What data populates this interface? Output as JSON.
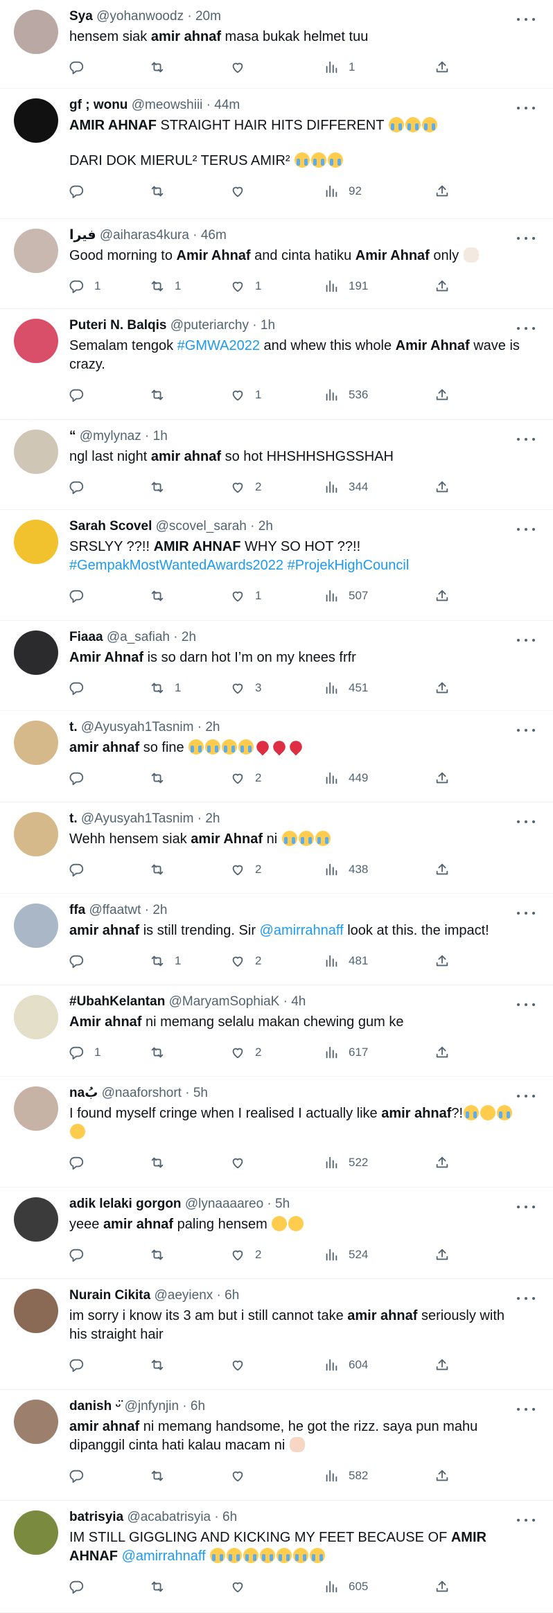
{
  "tweets": [
    {
      "name": "Sya",
      "handle": "@yohanwoodz",
      "time": "20m",
      "avatar": "#b9a8a3",
      "body": [
        [
          {
            "t": "hensem siak "
          },
          {
            "t": "amir ahnaf",
            "b": true
          },
          {
            "t": " masa bukak helmet tuu"
          }
        ]
      ],
      "reply": "",
      "retweet": "",
      "like": "",
      "views": "1",
      "h": 128
    },
    {
      "name": "gf ; wonu",
      "handle": "@meowshiii",
      "time": "44m",
      "avatar": "#111111",
      "body": [
        [
          {
            "t": "AMIR AHNAF",
            "b": true
          },
          {
            "t": " STRAIGHT HAIR HITS DIFFERENT "
          },
          {
            "e": "crying"
          },
          {
            "e": "crying"
          },
          {
            "e": "crying"
          }
        ],
        [
          {
            "t": "DARI DOK MIERUL² TERUS AMIR² "
          },
          {
            "e": "crying"
          },
          {
            "e": "crying"
          },
          {
            "e": "crying"
          }
        ]
      ],
      "reply": "",
      "retweet": "",
      "like": "",
      "views": "92",
      "h": 188
    },
    {
      "name": "فيرا",
      "handle": "@aiharas4kura",
      "time": "46m",
      "avatar": "#c8b8b0",
      "body": [
        [
          {
            "t": "Good morning to "
          },
          {
            "t": "Amir Ahnaf",
            "b": true
          },
          {
            "t": " and cinta hatiku "
          },
          {
            "t": "Amir Ahnaf",
            "b": true
          },
          {
            "t": " only "
          },
          {
            "e": "heart-hands"
          }
        ]
      ],
      "reply": "1",
      "retweet": "1",
      "like": "1",
      "views": "191",
      "h": 130
    },
    {
      "name": "Puteri N. Balqis",
      "handle": "@puteriarchy",
      "time": "1h",
      "avatar": "#d94f6a",
      "body": [
        [
          {
            "t": "Semalam tengok "
          },
          {
            "t": "#GMWA2022",
            "l": true
          },
          {
            "t": " and whew this whole "
          },
          {
            "t": "Amir Ahnaf",
            "b": true
          },
          {
            "t": " wave is crazy."
          }
        ]
      ],
      "reply": "",
      "retweet": "",
      "like": "1",
      "views": "536",
      "h": 160
    },
    {
      "name": "“",
      "handle": "@mylynaz",
      "time": "1h",
      "avatar": "#cfc6b6",
      "body": [
        [
          {
            "t": "ngl last night "
          },
          {
            "t": "amir ahnaf",
            "b": true
          },
          {
            "t": " so hot HHSHHSHGSSHAH"
          }
        ]
      ],
      "reply": "",
      "retweet": "",
      "like": "2",
      "views": "344",
      "h": 130
    },
    {
      "name": "Sarah Scovel",
      "handle": "@scovel_sarah",
      "time": "2h",
      "avatar": "#f2c12e",
      "body": [
        [
          {
            "t": "SRSLYY ??!! "
          },
          {
            "t": "AMIR AHNAF",
            "b": true
          },
          {
            "t": " WHY SO HOT ??!! "
          },
          {
            "t": "#GempakMostWantedAwards2022",
            "l": true
          },
          {
            "t": " "
          },
          {
            "t": "#ProjekHighCouncil",
            "l": true
          }
        ]
      ],
      "reply": "",
      "retweet": "",
      "like": "1",
      "views": "507",
      "h": 160
    },
    {
      "name": "Fiaaa",
      "handle": "@a_safiah",
      "time": "2h",
      "avatar": "#2b2a2c",
      "body": [
        [
          {
            "t": "Amir Ahnaf",
            "b": true
          },
          {
            "t": " is so darn hot I’m on my knees frfr"
          }
        ]
      ],
      "reply": "",
      "retweet": "1",
      "like": "3",
      "views": "451",
      "h": 130
    },
    {
      "name": "t.",
      "handle": "@Ayusyah1Tasnim",
      "time": "2h",
      "avatar": "#d6b98a",
      "body": [
        [
          {
            "t": "amir ahnaf",
            "b": true
          },
          {
            "t": " so fine "
          },
          {
            "e": "crying"
          },
          {
            "e": "crying"
          },
          {
            "e": "crying"
          },
          {
            "e": "crying"
          },
          {
            "e": "heart"
          },
          {
            "e": "heart"
          },
          {
            "e": "heart"
          }
        ]
      ],
      "reply": "",
      "retweet": "",
      "like": "2",
      "views": "449",
      "h": 132
    },
    {
      "name": "t.",
      "handle": "@Ayusyah1Tasnim",
      "time": "2h",
      "avatar": "#d6b98a",
      "body": [
        [
          {
            "t": "Wehh hensem siak "
          },
          {
            "t": "amir Ahnaf",
            "b": true
          },
          {
            "t": " ni "
          },
          {
            "e": "crying"
          },
          {
            "e": "crying"
          },
          {
            "e": "crying"
          }
        ]
      ],
      "reply": "",
      "retweet": "",
      "like": "2",
      "views": "438",
      "h": 132
    },
    {
      "name": "ffa",
      "handle": "@ffaatwt",
      "time": "2h",
      "avatar": "#a9b7c6",
      "body": [
        [
          {
            "t": "amir ahnaf",
            "b": true
          },
          {
            "t": " is still trending. Sir "
          },
          {
            "t": "@amirrahnaff",
            "l": true
          },
          {
            "t": " look at this. the impact!"
          }
        ]
      ],
      "reply": "",
      "retweet": "1",
      "like": "2",
      "views": "481",
      "h": 132
    },
    {
      "name": "#UbahKelantan",
      "handle": "@MaryamSophiaK",
      "time": "4h",
      "avatar": "#e3dfc9",
      "body": [
        [
          {
            "t": "Amir ahnaf",
            "b": true
          },
          {
            "t": " ni memang selalu makan chewing gum ke"
          }
        ]
      ],
      "reply": "1",
      "retweet": "",
      "like": "2",
      "views": "617",
      "h": 132
    },
    {
      "name": "naبُ",
      "handle": "@naaforshort",
      "time": "5h",
      "avatar": "#c7b3a6",
      "body": [
        [
          {
            "t": "I found myself cringe when I realised I actually like "
          },
          {
            "t": "amir ahnaf",
            "b": true
          },
          {
            "t": "?!"
          },
          {
            "e": "crying"
          },
          {
            "e": "rofl"
          },
          {
            "e": "crying"
          },
          {
            "e": "rofl"
          }
        ]
      ],
      "reply": "",
      "retweet": "",
      "like": "",
      "views": "522",
      "h": 160
    },
    {
      "name": "adik lelaki gorgon",
      "handle": "@lynaaaareo",
      "time": "5h",
      "avatar": "#3b3b3b",
      "body": [
        [
          {
            "t": "yeee "
          },
          {
            "t": "amir ahnaf",
            "b": true
          },
          {
            "t": " paling hensem "
          },
          {
            "e": "relieved"
          },
          {
            "e": "relieved"
          }
        ]
      ],
      "reply": "",
      "retweet": "",
      "like": "2",
      "views": "524",
      "h": 132
    },
    {
      "name": "Nurain Cikita",
      "handle": "@aeyienx",
      "time": "6h",
      "avatar": "#8a6a55",
      "body": [
        [
          {
            "t": "im sorry i know its 3 am but i still cannot take "
          },
          {
            "t": "amir ahnaf",
            "b": true
          },
          {
            "t": " seriously with his straight hair"
          }
        ]
      ],
      "reply": "",
      "retweet": "",
      "like": "",
      "views": "604",
      "h": 160
    },
    {
      "name": "danish ᵕ̈",
      "handle": "@jnfynjin",
      "time": "6h",
      "avatar": "#9c7f6c",
      "body": [
        [
          {
            "t": "amir ahnaf",
            "b": true
          },
          {
            "t": " ni memang handsome, he got the rizz. saya pun mahu dipanggil cinta hati kalau macam ni "
          },
          {
            "e": "hands"
          }
        ]
      ],
      "reply": "",
      "retweet": "",
      "like": "",
      "views": "582",
      "h": 160
    },
    {
      "name": "batrisyia",
      "handle": "@acabatrisyia",
      "time": "6h",
      "avatar": "#7a8a3e",
      "body": [
        [
          {
            "t": "IM STILL GIGGLING AND KICKING MY FEET BECAUSE OF "
          },
          {
            "t": "AMIR AHNAF",
            "b": true
          },
          {
            "t": " "
          },
          {
            "t": "@amirrahnaff",
            "l": true
          },
          {
            "t": " "
          },
          {
            "e": "crying"
          },
          {
            "e": "crying"
          },
          {
            "e": "crying"
          },
          {
            "e": "crying"
          },
          {
            "e": "crying"
          },
          {
            "e": "crying"
          },
          {
            "e": "crying"
          }
        ]
      ],
      "reply": "",
      "retweet": "",
      "like": "",
      "views": "605",
      "h": 162
    }
  ],
  "emoji_names": {
    "crying": "loudly-crying-face-emoji",
    "heart": "red-heart-emoji",
    "heart-hands": "heart-hands-emoji",
    "hands": "handshake-emoji",
    "rofl": "rolling-on-floor-laughing-emoji",
    "relieved": "relieved-face-emoji"
  },
  "colors": {
    "link": "#1d9bf0",
    "muted": "#536471",
    "text": "#0f1419",
    "divider": "#eff3f4"
  }
}
